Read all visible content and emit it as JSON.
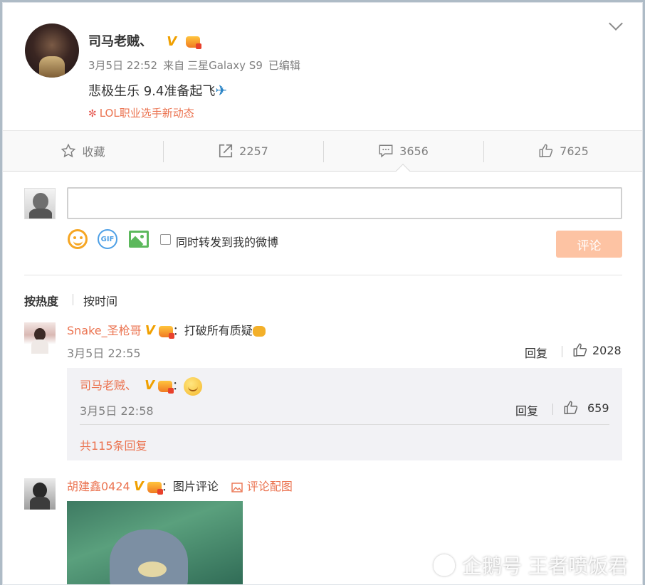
{
  "post": {
    "author": "司马老贼、",
    "verified": "V",
    "date": "3月5日 22:52",
    "source_prefix": "来自",
    "source": "三星Galaxy S9",
    "edited": "已编辑",
    "text": "悲极生乐 9.4准备起飞",
    "plane": "✈",
    "topic": "LOL职业选手新动态"
  },
  "actions": {
    "favorite": "收藏",
    "repost_count": "2257",
    "comment_count": "3656",
    "like_count": "7625"
  },
  "composer": {
    "gif_label": "GIF",
    "repost_option": "同时转发到我的微博",
    "submit": "评论"
  },
  "sort": {
    "hot": "按热度",
    "time": "按时间"
  },
  "comments": [
    {
      "name": "Snake_圣枪哥",
      "verified": "V",
      "text": "打破所有质疑",
      "date": "3月5日 22:55",
      "reply": "回复",
      "likes": "2028",
      "sub": {
        "name": "司马老贼、",
        "verified": "V",
        "date": "3月5日 22:58",
        "reply": "回复",
        "likes": "659",
        "more": "共115条回复"
      }
    },
    {
      "name": "胡建鑫0424",
      "verified": "V",
      "text": "图片评论",
      "pic_link": "评论配图"
    }
  ],
  "colon": "：",
  "watermark": "企鹅号 王者喷饭君"
}
